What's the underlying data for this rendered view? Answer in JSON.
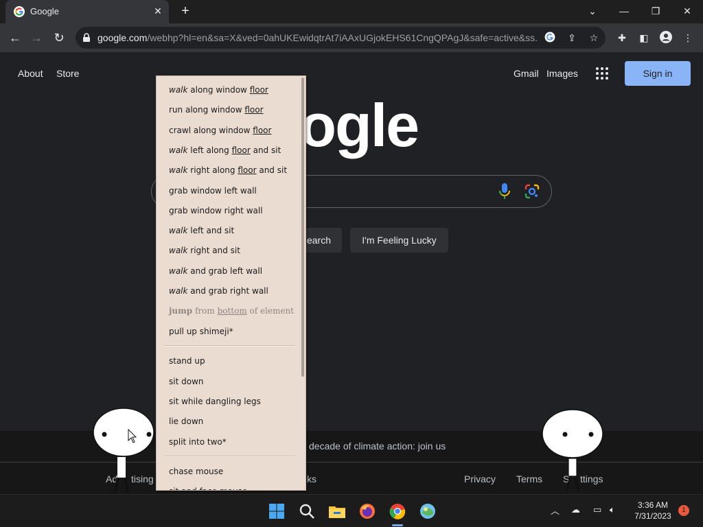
{
  "browser": {
    "tab_title": "Google",
    "url_host": "google.com",
    "url_path": "/webhp?hl=en&sa=X&ved=0ahUKEwidqtrAt7iAAxUGjokEHS61CngQPAgJ&safe=active&ss..."
  },
  "google": {
    "top_left_links": [
      "About",
      "Store"
    ],
    "gmail": "Gmail",
    "images": "Images",
    "sign_in": "Sign in",
    "logo_text": "oogle",
    "search_button": "earch",
    "lucky_button": "I'm Feeling Lucky",
    "climate_text": "decade of climate action: join us",
    "footer_left": [
      "Ad",
      "tising",
      "ks"
    ],
    "footer_right": [
      "Privacy",
      "Terms",
      "S",
      "ttings"
    ]
  },
  "menu": {
    "items": [
      {
        "parts": [
          {
            "t": "walk",
            "s": "em"
          },
          {
            "t": " along window "
          },
          {
            "t": "floor",
            "s": "u"
          }
        ]
      },
      {
        "parts": [
          {
            "t": "run along window "
          },
          {
            "t": "floor",
            "s": "u"
          }
        ]
      },
      {
        "parts": [
          {
            "t": "crawl along window "
          },
          {
            "t": "floor",
            "s": "u"
          }
        ]
      },
      {
        "parts": [
          {
            "t": "walk",
            "s": "em"
          },
          {
            "t": " left along "
          },
          {
            "t": "floor",
            "s": "u"
          },
          {
            "t": " and sit"
          }
        ]
      },
      {
        "parts": [
          {
            "t": "walk",
            "s": "em"
          },
          {
            "t": " right along "
          },
          {
            "t": "floor",
            "s": "u"
          },
          {
            "t": " and sit"
          }
        ]
      },
      {
        "parts": [
          {
            "t": "grab window left wall"
          }
        ]
      },
      {
        "parts": [
          {
            "t": "grab window right wall"
          }
        ]
      },
      {
        "parts": [
          {
            "t": "walk",
            "s": "em"
          },
          {
            "t": " left and sit"
          }
        ]
      },
      {
        "parts": [
          {
            "t": "walk",
            "s": "em"
          },
          {
            "t": " right and sit"
          }
        ]
      },
      {
        "parts": [
          {
            "t": "walk",
            "s": "em"
          },
          {
            "t": " and grab left wall"
          }
        ]
      },
      {
        "parts": [
          {
            "t": "walk",
            "s": "em"
          },
          {
            "t": " and grab right wall"
          }
        ]
      },
      {
        "parts": [
          {
            "t": "jump",
            "s": "b"
          },
          {
            "t": " from "
          },
          {
            "t": "bottom",
            "s": "u"
          },
          {
            "t": " of element"
          }
        ],
        "disabled": true
      },
      {
        "parts": [
          {
            "t": "pull up shimeji*"
          }
        ]
      },
      {
        "parts": [
          {
            "t": "stand up"
          }
        ]
      },
      {
        "parts": [
          {
            "t": "sit down"
          }
        ]
      },
      {
        "parts": [
          {
            "t": "sit while dangling legs"
          }
        ]
      },
      {
        "parts": [
          {
            "t": "lie down"
          }
        ]
      },
      {
        "parts": [
          {
            "t": "split into two*"
          }
        ]
      },
      {
        "parts": [
          {
            "t": "chase mouse"
          }
        ]
      },
      {
        "parts": [
          {
            "t": "sit and face mouse"
          }
        ]
      }
    ]
  },
  "taskbar": {
    "time": "3:36 AM",
    "date": "7/31/2023",
    "notification_count": "1"
  },
  "colors": {
    "page_bg": "#202124",
    "sign_in_bg": "#8ab4f8",
    "menu_bg": "#ebdcd2",
    "chrome_toolbar": "#35363a"
  }
}
